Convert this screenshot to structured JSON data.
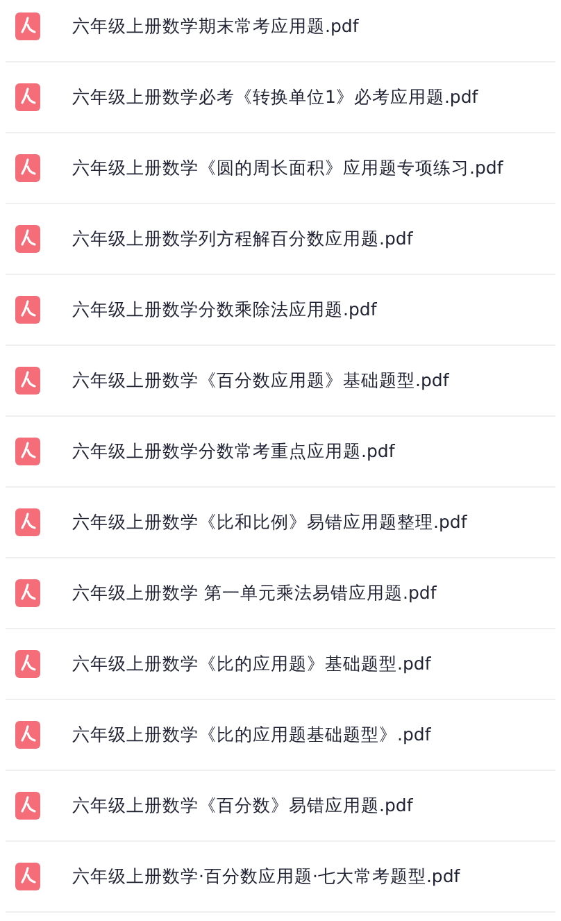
{
  "files": [
    {
      "name": "六年级上册数学期末常考应用题.pdf"
    },
    {
      "name": "六年级上册数学必考《转换单位1》必考应用题.pdf"
    },
    {
      "name": "六年级上册数学《圆的周长面积》应用题专项练习.pdf"
    },
    {
      "name": "六年级上册数学列方程解百分数应用题.pdf"
    },
    {
      "name": "六年级上册数学分数乘除法应用题.pdf"
    },
    {
      "name": "六年级上册数学《百分数应用题》基础题型.pdf"
    },
    {
      "name": "六年级上册数学分数常考重点应用题.pdf"
    },
    {
      "name": "六年级上册数学《比和比例》易错应用题整理.pdf"
    },
    {
      "name": "六年级上册数学 第一单元乘法易错应用题.pdf"
    },
    {
      "name": "六年级上册数学《比的应用题》基础题型.pdf"
    },
    {
      "name": "六年级上册数学《比的应用题基础题型》.pdf"
    },
    {
      "name": "六年级上册数学《百分数》易错应用题.pdf"
    },
    {
      "name": "六年级上册数学·百分数应用题·七大常考题型.pdf"
    }
  ]
}
